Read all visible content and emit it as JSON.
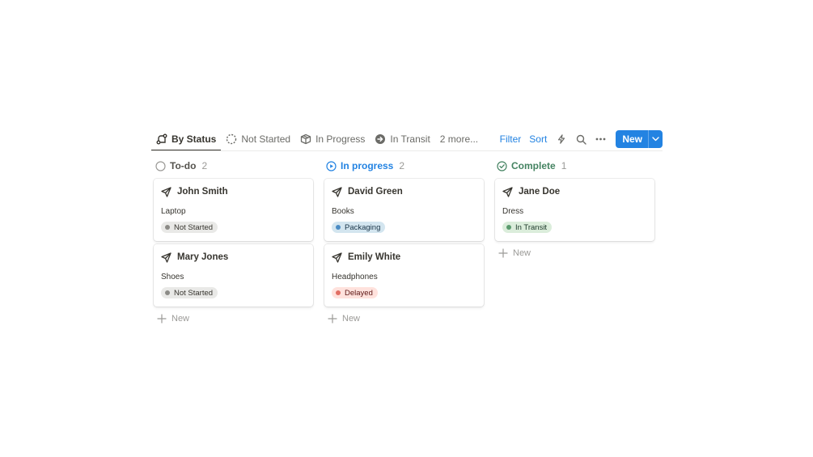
{
  "toolbar": {
    "tabs": [
      {
        "label": "By Status",
        "icon": "status-flow-icon",
        "active": true
      },
      {
        "label": "Not Started",
        "icon": "dashed-circle-icon",
        "active": false
      },
      {
        "label": "In Progress",
        "icon": "box-icon",
        "active": false
      },
      {
        "label": "In Transit",
        "icon": "arrow-circle-icon",
        "active": false
      }
    ],
    "more_label": "2 more...",
    "filter_label": "Filter",
    "sort_label": "Sort",
    "new_label": "New"
  },
  "columns": [
    {
      "title": "To-do",
      "count": "2",
      "status_icon": "empty-circle-icon",
      "color": "#55534e",
      "cards": [
        {
          "name": "John Smith",
          "item": "Laptop",
          "status": "Not Started",
          "status_color": "gray"
        },
        {
          "name": "Mary Jones",
          "item": "Shoes",
          "status": "Not Started",
          "status_color": "gray"
        }
      ],
      "new_label": "New"
    },
    {
      "title": "In progress",
      "count": "2",
      "status_icon": "play-circle-icon",
      "color": "#2383e2",
      "cards": [
        {
          "name": "David Green",
          "item": "Books",
          "status": "Packaging",
          "status_color": "blue"
        },
        {
          "name": "Emily White",
          "item": "Headphones",
          "status": "Delayed",
          "status_color": "red"
        }
      ],
      "new_label": "New"
    },
    {
      "title": "Complete",
      "count": "1",
      "status_icon": "check-circle-icon",
      "color": "#448361",
      "cards": [
        {
          "name": "Jane Doe",
          "item": "Dress",
          "status": "In Transit",
          "status_color": "green"
        }
      ],
      "new_label": "New"
    }
  ]
}
